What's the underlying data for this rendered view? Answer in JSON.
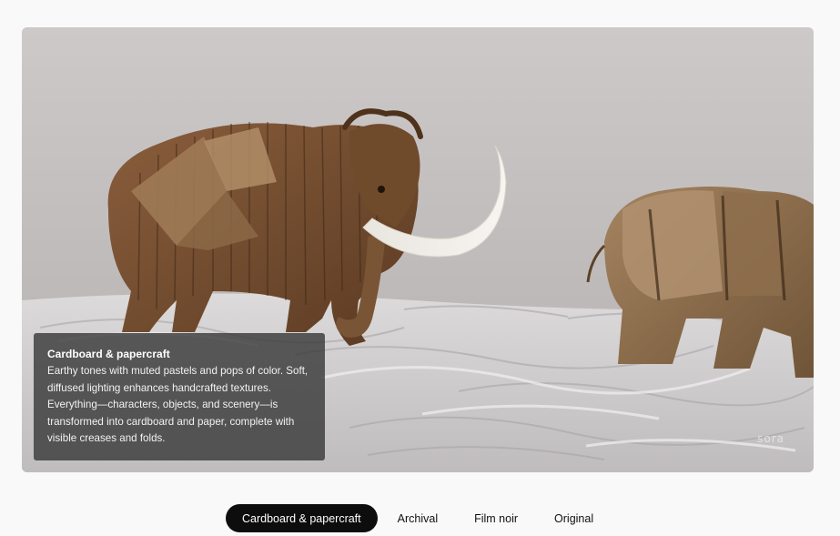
{
  "media": {
    "description_alt": "Cardboard mammoth and rhino on white textured ground",
    "watermark": "sora"
  },
  "caption": {
    "title": "Cardboard & papercraft",
    "body": "Earthy tones with muted pastels and pops of color. Soft, diffused lighting enhances handcrafted textures. Everything—characters, objects, and scenery—is transformed into cardboard and paper, complete with visible creases and folds."
  },
  "tabs": [
    {
      "label": "Cardboard & papercraft",
      "active": true
    },
    {
      "label": "Archival",
      "active": false
    },
    {
      "label": "Film noir",
      "active": false
    },
    {
      "label": "Original",
      "active": false
    }
  ],
  "colors": {
    "page_bg": "#f9f9f9",
    "active_tab_bg": "#0d0d0d",
    "caption_bg": "#3a3a3a"
  }
}
